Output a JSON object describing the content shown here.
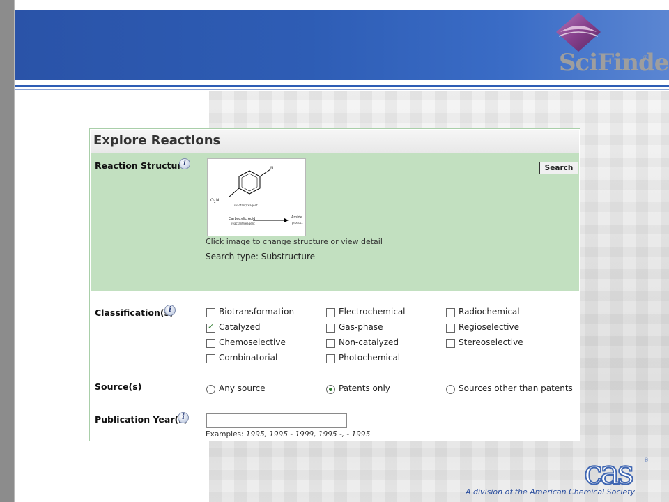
{
  "brand": {
    "app_name": "SciFinder",
    "trademark": "®",
    "company": "cas",
    "company_trademark": "®",
    "tagline": "A division of the American Chemical Society",
    "colors": {
      "header_blue": "#2e5db5",
      "panel_green": "#c2e0c0",
      "logo_purple": "#9a3c8a"
    }
  },
  "panel": {
    "title": "Explore Reactions",
    "reaction_structure": {
      "label": "Reaction Structure",
      "info_glyph": "i",
      "search_button": "Search",
      "hint": "Click image to change structure or view detail",
      "search_type": "Search type: Substructure",
      "diagram": {
        "atom_n_top": "N",
        "atom_o2n": "O",
        "atom_sub2": "2",
        "atom_n_left": "N",
        "role_reactant": "reactant/reagent",
        "left_name": "Carboxylic Acid",
        "left_role": "reactant/reagent",
        "right_name": "Amide",
        "right_role": "product"
      }
    },
    "classifications": {
      "label": "Classification(s)",
      "info_glyph": "i",
      "check_glyph": "✓",
      "items": [
        {
          "label": "Biotransformation",
          "checked": false
        },
        {
          "label": "Electrochemical",
          "checked": false
        },
        {
          "label": "Radiochemical",
          "checked": false
        },
        {
          "label": "Catalyzed",
          "checked": true
        },
        {
          "label": "Gas-phase",
          "checked": false
        },
        {
          "label": "Regioselective",
          "checked": false
        },
        {
          "label": "Chemoselective",
          "checked": false
        },
        {
          "label": "Non-catalyzed",
          "checked": false
        },
        {
          "label": "Stereoselective",
          "checked": false
        },
        {
          "label": "Combinatorial",
          "checked": false
        },
        {
          "label": "Photochemical",
          "checked": false
        }
      ]
    },
    "sources": {
      "label": "Source(s)",
      "options": [
        {
          "label": "Any source",
          "selected": false
        },
        {
          "label": "Patents only",
          "selected": true
        },
        {
          "label": "Sources other than patents",
          "selected": false
        }
      ]
    },
    "publication_year": {
      "label": "Publication Year(s)",
      "info_glyph": "i",
      "value": "",
      "examples_prefix": "Examples:",
      "examples_values": "1995, 1995 - 1999, 1995 -, - 1995"
    }
  }
}
